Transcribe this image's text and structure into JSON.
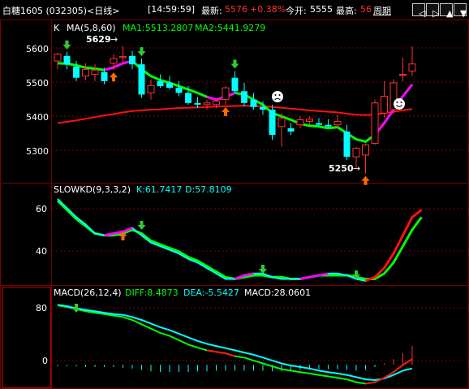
{
  "header": {
    "symbol": "白糖1605 (032305)",
    "period": "<日线>",
    "time": "[14:59:59]",
    "last_label": "最新:",
    "last_value": "5576",
    "change": "+0.38%",
    "open_label": "今开:",
    "open_value": "5555",
    "high_label": "最高:",
    "high_value": "56",
    "weekly": "周期"
  },
  "nav": {
    "left": "◁",
    "right": "▷",
    "up": "▲",
    "down": "▼"
  },
  "colors": {
    "up": "#ff3030",
    "down": "#00ffff",
    "ma1": "#00ff00",
    "ma_hl": "#ff00ff",
    "ma2": "#ff1010",
    "k": "#00ffff",
    "d": "#ff00ff",
    "diff": "#00ff00",
    "dea": "#00ffff",
    "grid": "#7a0000"
  },
  "panels": {
    "main": {
      "k_label": "K",
      "ma_label": "MA(5,8,60)",
      "ma1_text": "MA1:5513.2807",
      "ma2_text": "MA2:5441.9279",
      "high_annot": "5629",
      "low_annot": "5250",
      "yticks": [
        "5600",
        "5500",
        "5400",
        "5300"
      ]
    },
    "kd": {
      "label": "SLOWKD(9,3,3,2)",
      "k_text": "K:61.7417",
      "d_text": "D:57.8109",
      "yticks": [
        "60",
        "40"
      ]
    },
    "macd": {
      "label": "MACD(26,12,4)",
      "diff_text": "DIFF:8.4873",
      "dea_text": "DEA:-5.5427",
      "macd_text": "MACD:28.0601",
      "yticks": [
        "80",
        "0"
      ]
    }
  },
  "chart_data": [
    {
      "type": "candlestick",
      "title": "白糖1605 日线",
      "ylim": [
        5230,
        5660
      ],
      "candles": [
        {
          "o": 5585,
          "h": 5610,
          "l": 5560,
          "c": 5605
        },
        {
          "o": 5600,
          "h": 5612,
          "l": 5560,
          "c": 5575
        },
        {
          "o": 5568,
          "h": 5585,
          "l": 5525,
          "c": 5535
        },
        {
          "o": 5540,
          "h": 5578,
          "l": 5528,
          "c": 5560
        },
        {
          "o": 5545,
          "h": 5575,
          "l": 5525,
          "c": 5558
        },
        {
          "o": 5552,
          "h": 5565,
          "l": 5515,
          "c": 5525
        },
        {
          "o": 5578,
          "h": 5605,
          "l": 5558,
          "c": 5592
        },
        {
          "o": 5595,
          "h": 5629,
          "l": 5580,
          "c": 5598
        },
        {
          "o": 5600,
          "h": 5615,
          "l": 5560,
          "c": 5575
        },
        {
          "o": 5575,
          "h": 5592,
          "l": 5475,
          "c": 5485
        },
        {
          "o": 5490,
          "h": 5530,
          "l": 5470,
          "c": 5512
        },
        {
          "o": 5525,
          "h": 5545,
          "l": 5505,
          "c": 5510
        },
        {
          "o": 5520,
          "h": 5540,
          "l": 5500,
          "c": 5505
        },
        {
          "o": 5505,
          "h": 5525,
          "l": 5480,
          "c": 5490
        },
        {
          "o": 5490,
          "h": 5510,
          "l": 5455,
          "c": 5460
        },
        {
          "o": 5460,
          "h": 5478,
          "l": 5445,
          "c": 5455
        },
        {
          "o": 5455,
          "h": 5470,
          "l": 5440,
          "c": 5460
        },
        {
          "o": 5455,
          "h": 5470,
          "l": 5445,
          "c": 5465
        },
        {
          "o": 5470,
          "h": 5510,
          "l": 5455,
          "c": 5505
        },
        {
          "o": 5535,
          "h": 5555,
          "l": 5490,
          "c": 5495
        },
        {
          "o": 5495,
          "h": 5520,
          "l": 5450,
          "c": 5460
        },
        {
          "o": 5470,
          "h": 5490,
          "l": 5440,
          "c": 5448
        },
        {
          "o": 5448,
          "h": 5465,
          "l": 5425,
          "c": 5440
        },
        {
          "o": 5440,
          "h": 5455,
          "l": 5350,
          "c": 5365
        },
        {
          "o": 5390,
          "h": 5430,
          "l": 5330,
          "c": 5415
        },
        {
          "o": 5385,
          "h": 5400,
          "l": 5365,
          "c": 5375
        },
        {
          "o": 5395,
          "h": 5420,
          "l": 5385,
          "c": 5410
        },
        {
          "o": 5405,
          "h": 5420,
          "l": 5395,
          "c": 5412
        },
        {
          "o": 5400,
          "h": 5415,
          "l": 5390,
          "c": 5395
        },
        {
          "o": 5395,
          "h": 5412,
          "l": 5385,
          "c": 5390
        },
        {
          "o": 5395,
          "h": 5425,
          "l": 5385,
          "c": 5405
        },
        {
          "o": 5375,
          "h": 5395,
          "l": 5290,
          "c": 5300
        },
        {
          "o": 5300,
          "h": 5330,
          "l": 5265,
          "c": 5325
        },
        {
          "o": 5305,
          "h": 5340,
          "l": 5250,
          "c": 5335
        },
        {
          "o": 5340,
          "h": 5470,
          "l": 5335,
          "c": 5460
        },
        {
          "o": 5430,
          "h": 5525,
          "l": 5415,
          "c": 5480
        },
        {
          "o": 5440,
          "h": 5530,
          "l": 5430,
          "c": 5520
        },
        {
          "o": 5545,
          "h": 5595,
          "l": 5525,
          "c": 5545
        },
        {
          "o": 5555,
          "h": 5629,
          "l": 5540,
          "c": 5576
        }
      ],
      "ma1": [
        5578,
        5577,
        5572,
        5565,
        5562,
        5558,
        5566,
        5578,
        5585,
        5560,
        5540,
        5528,
        5520,
        5510,
        5500,
        5490,
        5478,
        5470,
        5478,
        5490,
        5485,
        5470,
        5455,
        5430,
        5420,
        5410,
        5398,
        5392,
        5390,
        5385,
        5388,
        5370,
        5352,
        5345,
        5365,
        5400,
        5440,
        5480,
        5515
      ],
      "ma1_highlight_idx": [
        [
          5,
          8
        ],
        [
          16,
          19
        ],
        [
          34,
          38
        ]
      ],
      "ma2": [
        5400,
        5404,
        5408,
        5413,
        5418,
        5423,
        5427,
        5432,
        5436,
        5438,
        5440,
        5441,
        5443,
        5445,
        5446,
        5447,
        5448,
        5449,
        5450,
        5451,
        5452,
        5451,
        5450,
        5448,
        5446,
        5443,
        5441,
        5438,
        5436,
        5434,
        5432,
        5428,
        5425,
        5424,
        5426,
        5430,
        5434,
        5438,
        5442
      ],
      "signals": [
        {
          "i": 1,
          "type": "sell"
        },
        {
          "i": 6,
          "type": "buy"
        },
        {
          "i": 9,
          "type": "sell"
        },
        {
          "i": 18,
          "type": "buy"
        },
        {
          "i": 19,
          "type": "sell"
        },
        {
          "i": 33,
          "type": "buy"
        }
      ]
    },
    {
      "type": "line",
      "title": "SLOWKD(9,3,3,2)",
      "ylim": [
        22,
        72
      ],
      "series": [
        {
          "name": "K",
          "values": [
            68,
            63,
            58,
            54,
            49,
            48,
            49,
            50,
            52,
            48,
            44,
            42,
            40,
            38,
            35,
            33,
            30,
            27,
            24,
            24,
            26,
            27,
            27,
            25,
            24,
            24,
            24,
            25,
            26,
            27,
            27,
            26,
            24,
            23,
            25,
            30,
            38,
            48,
            58,
            62
          ]
        },
        {
          "name": "D",
          "values": [
            67,
            62,
            57,
            53,
            49,
            48,
            48,
            49,
            51,
            49,
            45,
            43,
            41,
            39,
            36,
            34,
            31,
            28,
            25,
            24,
            25,
            26,
            26,
            25,
            25,
            24,
            24,
            25,
            26,
            26,
            26,
            26,
            25,
            24,
            24,
            27,
            33,
            42,
            51,
            58
          ]
        }
      ]
    },
    {
      "type": "line",
      "title": "MACD(26,12,4)",
      "ylim": [
        -30,
        90
      ],
      "series": [
        {
          "name": "DIFF",
          "values": [
            82,
            80,
            77,
            74,
            72,
            70,
            68,
            66,
            62,
            56,
            50,
            44,
            40,
            34,
            28,
            24,
            20,
            18,
            16,
            12,
            10,
            6,
            2,
            -2,
            -6,
            -8,
            -10,
            -12,
            -14,
            -16,
            -18,
            -20,
            -24,
            -26,
            -24,
            -18,
            -10,
            0,
            8
          ]
        },
        {
          "name": "DEA",
          "values": [
            83,
            81,
            78,
            76,
            74,
            72,
            70,
            69,
            66,
            62,
            57,
            52,
            48,
            43,
            38,
            33,
            29,
            26,
            23,
            20,
            17,
            14,
            10,
            6,
            2,
            -1,
            -3,
            -5,
            -8,
            -10,
            -12,
            -14,
            -17,
            -20,
            -21,
            -19,
            -14,
            -8,
            -5
          ]
        }
      ],
      "bars": [
        -2,
        -2,
        -2,
        -3,
        -3,
        -3,
        -3,
        -4,
        -5,
        -7,
        -9,
        -10,
        -10,
        -10,
        -10,
        -9,
        -9,
        -8,
        -8,
        -8,
        -8,
        -8,
        -8,
        -9,
        -9,
        -8,
        -7,
        -7,
        -6,
        -6,
        -6,
        -7,
        -8,
        -7,
        -3,
        2,
        8,
        16,
        26
      ]
    }
  ]
}
